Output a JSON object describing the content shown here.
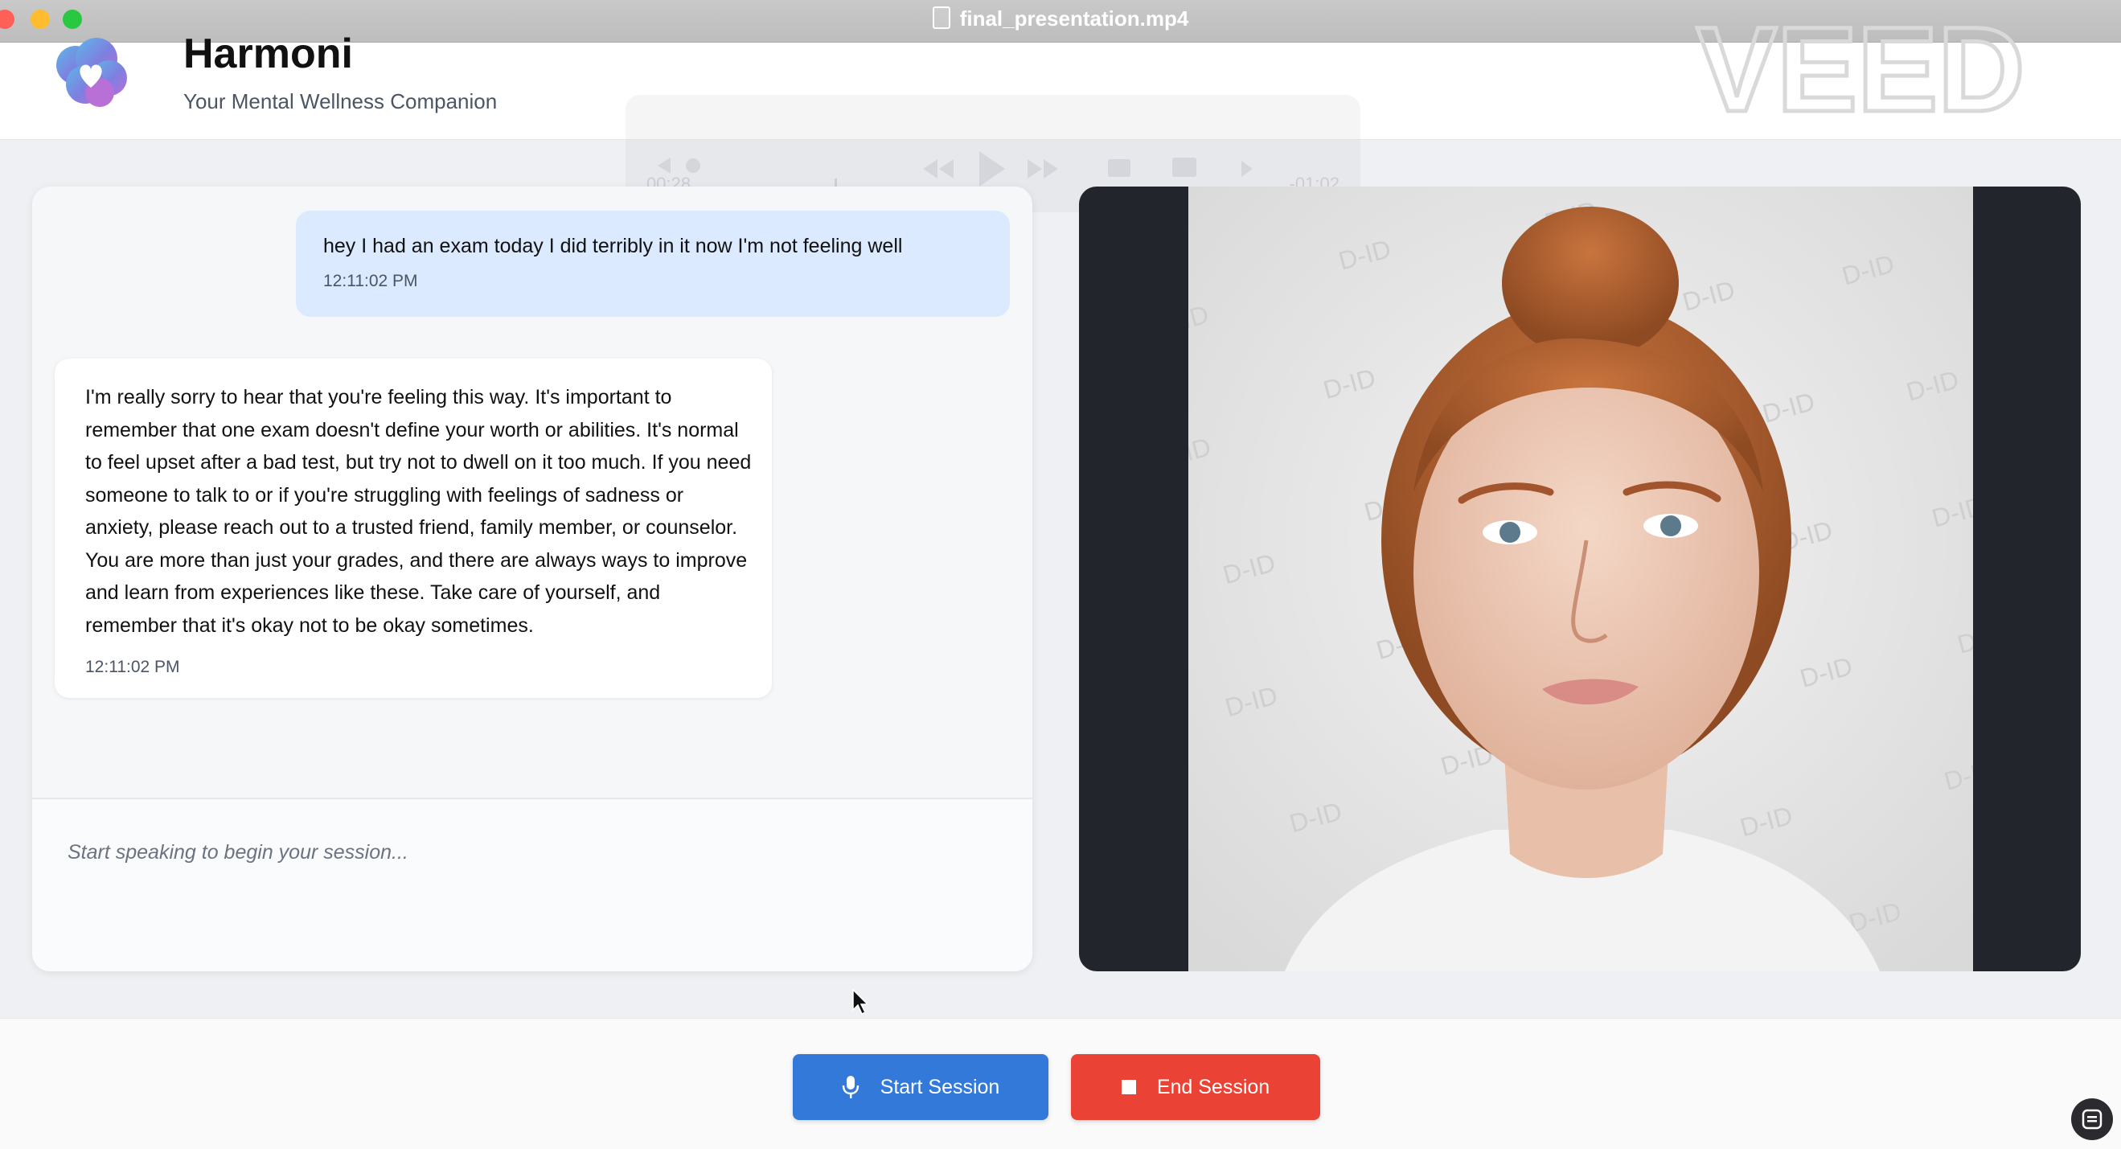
{
  "window": {
    "title": "final_presentation.mp4"
  },
  "header": {
    "app_name": "Harmoni",
    "tagline": "Your Mental Wellness Companion",
    "watermark": "VEED"
  },
  "overlay": {
    "elapsed": "00:28",
    "remaining": "-01:02"
  },
  "chat": {
    "messages": [
      {
        "role": "user",
        "text": "hey I had an exam today I did terribly in it now I'm not feeling well",
        "time": "12:11:02 PM"
      },
      {
        "role": "assistant",
        "text": "I'm really sorry to hear that you're feeling this way. It's important to remember that one exam doesn't define your worth or abilities. It's normal to feel upset after a bad test, but try not to dwell on it too much. If you need someone to talk to or if you're struggling with feelings of sadness or anxiety, please reach out to a trusted friend, family member, or counselor. You are more than just your grades, and there are always ways to improve and learn from experiences like these. Take care of yourself, and remember that it's okay not to be okay sometimes.",
        "time": "12:11:02 PM"
      }
    ],
    "input_placeholder": "Start speaking to begin your session..."
  },
  "video": {
    "watermark_text": "D-ID"
  },
  "controls": {
    "start_label": "Start Session",
    "end_label": "End Session"
  },
  "colors": {
    "primary": "#3279d9",
    "danger": "#ea4336",
    "user_bubble": "#dbeafe",
    "video_bg": "#22252b"
  }
}
